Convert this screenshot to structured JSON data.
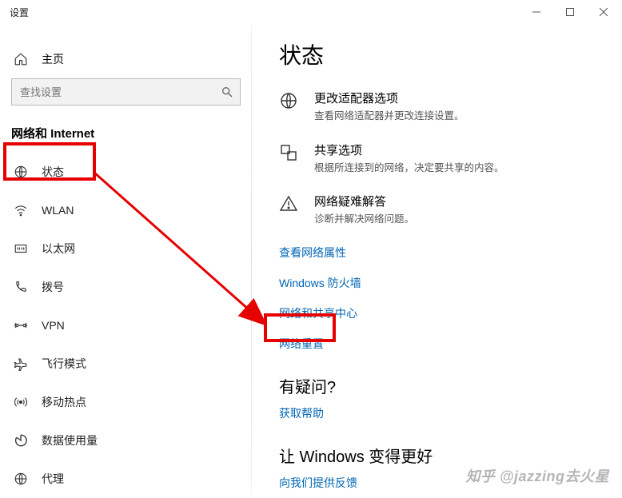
{
  "window": {
    "title": "设置"
  },
  "sidebar": {
    "home_label": "主页",
    "search_placeholder": "查找设置",
    "section_header": "网络和 Internet",
    "items": [
      {
        "label": "状态"
      },
      {
        "label": "WLAN"
      },
      {
        "label": "以太网"
      },
      {
        "label": "拨号"
      },
      {
        "label": "VPN"
      },
      {
        "label": "飞行模式"
      },
      {
        "label": "移动热点"
      },
      {
        "label": "数据使用量"
      },
      {
        "label": "代理"
      }
    ]
  },
  "main": {
    "page_title": "状态",
    "options": [
      {
        "title": "更改适配器选项",
        "desc": "查看网络适配器并更改连接设置。"
      },
      {
        "title": "共享选项",
        "desc": "根据所连接到的网络，决定要共享的内容。"
      },
      {
        "title": "网络疑难解答",
        "desc": "诊断并解决网络问题。"
      }
    ],
    "links": [
      "查看网络属性",
      "Windows 防火墙",
      "网络和共享中心",
      "网络重置"
    ],
    "faq_heading": "有疑问?",
    "faq_link": "获取帮助",
    "improve_heading": "让 Windows 变得更好",
    "improve_link": "向我们提供反馈"
  },
  "watermark": "知乎 @jazzing去火星"
}
